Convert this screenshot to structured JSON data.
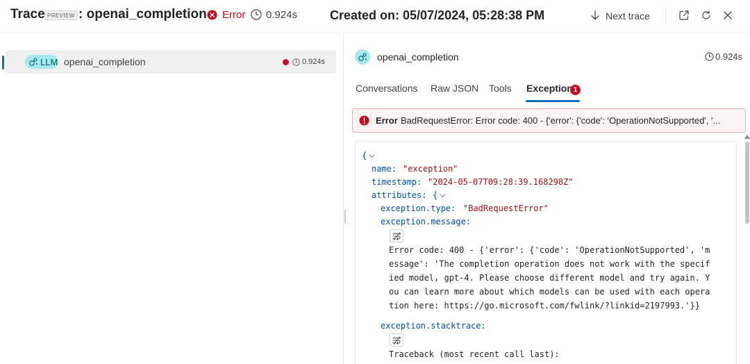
{
  "header": {
    "title": "Trace",
    "preview_badge": "PREVIEW",
    "trace_name": ": openai_completion",
    "status_text": "Error",
    "duration": "0.924s",
    "created_on": "Created on: 05/07/2024, 05:28:38 PM",
    "next_trace_label": "Next trace"
  },
  "tree": {
    "items": [
      {
        "kind": "LLM",
        "name": "openai_completion",
        "duration": "0.924s",
        "status": "error"
      }
    ]
  },
  "detail": {
    "name": "openai_completion",
    "duration": "0.924s",
    "tabs": [
      {
        "label": "Conversations"
      },
      {
        "label": "Raw JSON"
      },
      {
        "label": "Tools"
      },
      {
        "label": "Exception",
        "badge": "1",
        "active": true
      }
    ],
    "error_bar": {
      "title": "Error",
      "message": "BadRequestError: Error code: 400 - {'error': {'code': 'OperationNotSupported', '..."
    },
    "json": {
      "open_brace": "{",
      "name_key": "name:",
      "name_val": "\"exception\"",
      "ts_key": "timestamp:",
      "ts_val": "\"2024-05-07T09:28:39.168298Z\"",
      "attr_key": "attributes:",
      "attr_brace": "{",
      "type_key": "exception.type:",
      "type_val": "\"BadRequestError\"",
      "msg_key": "exception.message:",
      "msg_lines": [
        "Error code: 400 - {'error': {'code': 'OperationNotSupported', 'm",
        "essage': 'The completion operation does not work with the specif",
        "ied model, gpt-4. Please choose different model and try again. Y",
        "ou can learn more about which models can be used with each opera",
        "tion here: https://go.microsoft.com/fwlink/?linkid=2197993.'}}"
      ],
      "stack_key": "exception.stacktrace:",
      "stack_lines": [
        "Traceback (most recent call last):"
      ]
    }
  },
  "colors": {
    "accent": "#0f6cbd",
    "error": "#c50f1f",
    "llm_pill": "#a6e9ed"
  }
}
